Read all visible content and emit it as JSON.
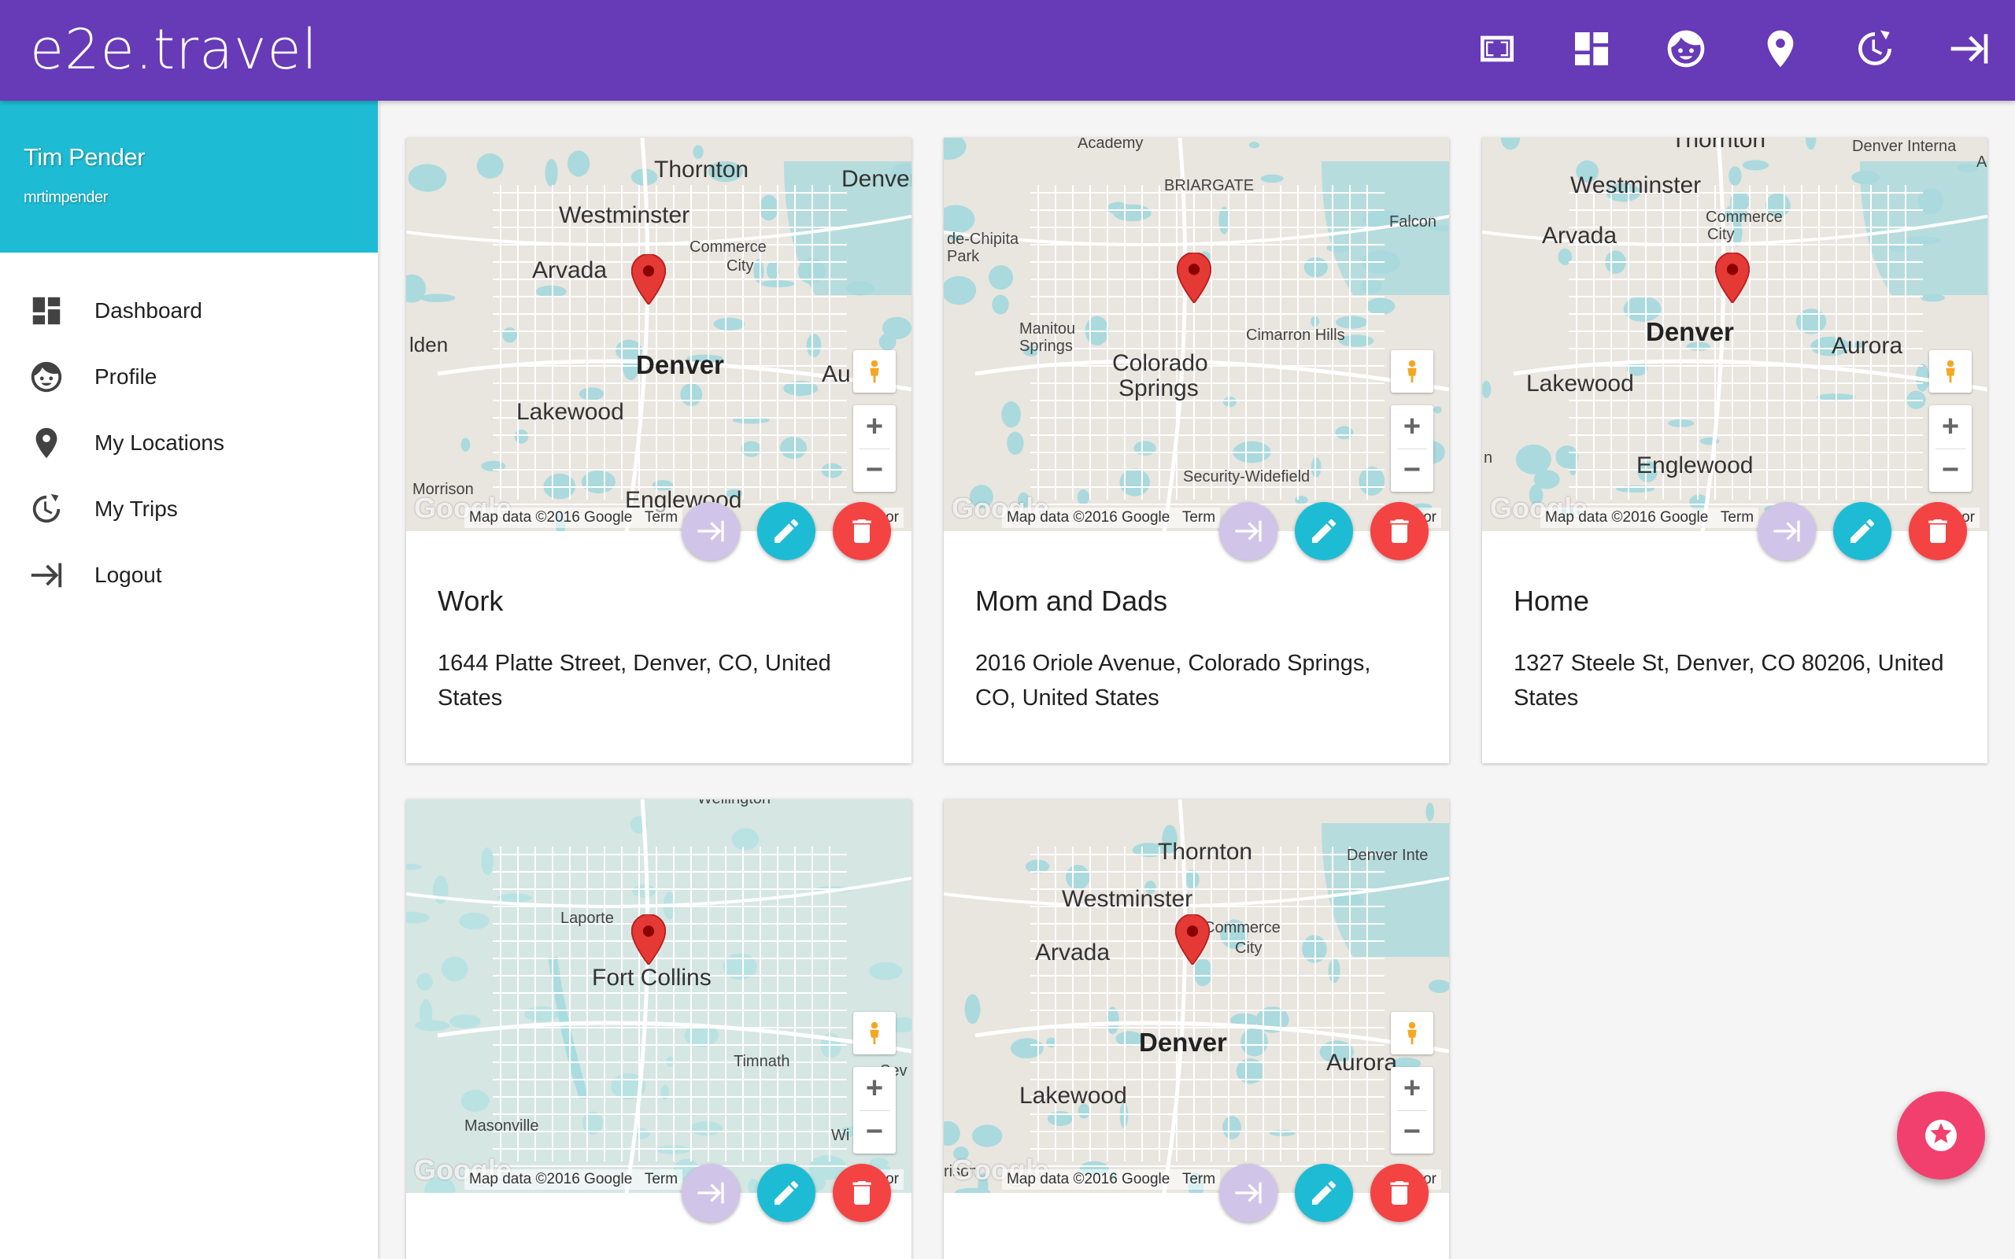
{
  "app": {
    "logo": "e2e.travel",
    "topbar_icons": [
      "fullscreen-icon",
      "dashboard-icon",
      "profile-icon",
      "location-icon",
      "trips-icon",
      "logout-icon"
    ]
  },
  "user": {
    "name": "Tim Pender",
    "handle": "mrtimpender"
  },
  "nav": [
    {
      "label": "Dashboard",
      "icon": "dashboard-icon"
    },
    {
      "label": "Profile",
      "icon": "profile-icon"
    },
    {
      "label": "My Locations",
      "icon": "location-icon"
    },
    {
      "label": "My Trips",
      "icon": "trips-icon"
    },
    {
      "label": "Logout",
      "icon": "logout-icon"
    }
  ],
  "map_common": {
    "attribution": "Map data ©2016 Google",
    "terms": "Term",
    "report": "or",
    "google": "Google"
  },
  "locations": [
    {
      "title": "Work",
      "address": "1644 Platte Street, Denver, CO, United States",
      "places": [
        "Thornton",
        "Denver",
        "Westminster",
        "Commerce",
        "City",
        "Arvada",
        "lden",
        "Denver",
        "Au",
        "Lakewood",
        "Morrison",
        "Englewood"
      ]
    },
    {
      "title": "Mom and Dads",
      "address": "2016 Oriole Avenue, Colorado Springs, CO, United States",
      "places": [
        "Academy",
        "BRIARGATE",
        "de-Chipita",
        "Park",
        "Falcon",
        "Manitou",
        "Springs",
        "Colorado",
        "Springs",
        "Cimarron Hills",
        "Security-Widefield"
      ]
    },
    {
      "title": "Home",
      "address": "1327 Steele St, Denver, CO 80206, United States",
      "places": [
        "Thornton",
        "Denver Interna",
        "A",
        "Westminster",
        "Commerce",
        "City",
        "Arvada",
        "Denver",
        "Aurora",
        "Lakewood",
        "Englewood",
        "n"
      ]
    },
    {
      "title": "",
      "address": "",
      "places": [
        "Wellington",
        "Laporte",
        "Fort Collins",
        "Timnath",
        "Sev",
        "Masonville",
        "Wi"
      ]
    },
    {
      "title": "",
      "address": "",
      "places": [
        "Thornton",
        "Denver Inte",
        "Westminster",
        "Commerce",
        "City",
        "Arvada",
        "Denver",
        "Aurora",
        "Lakewood",
        "rison"
      ]
    }
  ],
  "colors": {
    "topbar": "#673ab7",
    "user_header": "#1ebcd4",
    "edit_button": "#1ebcd4",
    "delete_button": "#f44343",
    "go_button": "#d1c4e9",
    "main_fab": "#f2406e"
  }
}
